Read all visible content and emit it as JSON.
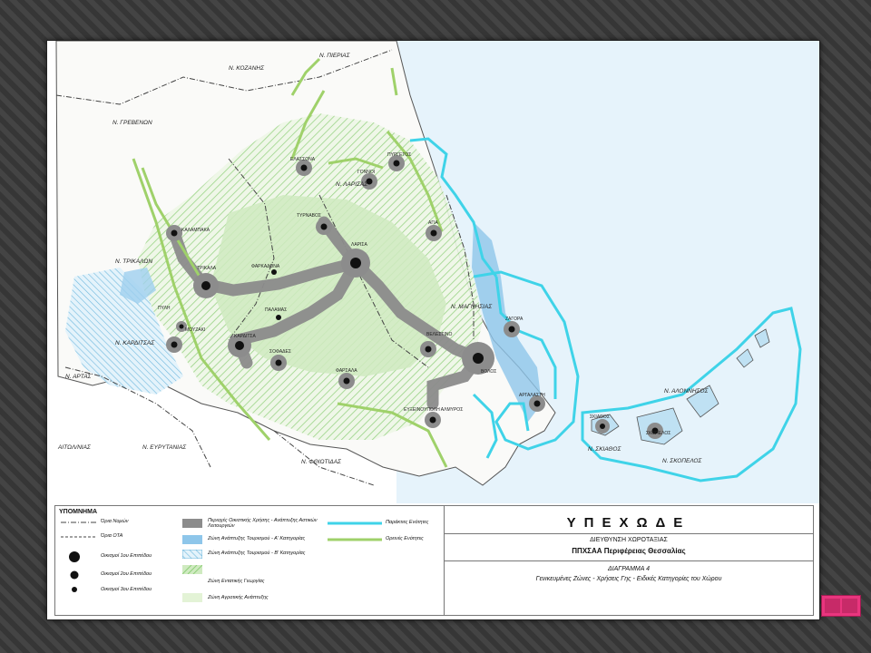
{
  "map": {
    "regions": {
      "kozani": "Ν. ΚΟΖΑΝΗΣ",
      "pieria": "Ν. ΠΙΕΡΙΑΣ",
      "grevena": "Ν. ΓΡΕΒΕΝΩΝ",
      "larisa": "Ν. ΛΑΡΙΣΑΣ",
      "trikala": "Ν. ΤΡΙΚΑΛΩΝ",
      "magnisia": "Ν. ΜΑΓΝΗΣΙΑΣ",
      "karditsa": "Ν. ΚΑΡΔΙΤΣΑΣ",
      "arta": "Ν. ΑΡΤΑΣ",
      "aitoloakarnania": "ΑΙΤΩΛ/ΝΙΑΣ",
      "evrytania": "Ν. ΕΥΡΥΤΑΝΙΑΣ",
      "fthiotida": "Ν. ΦΘΙΩΤΙΔΑΣ",
      "alonnisos": "Ν. ΑΛΟΝΝΗΣΟΣ",
      "skiathos": "Ν. ΣΚΙΑΘΟΣ",
      "skopelos": "Ν. ΣΚΟΠΕΛΟΣ"
    },
    "towns": {
      "elassona": "ΕΛΑΣΣΟΝΑ",
      "gonnoi": "ΓΟΝΝΟΙ",
      "pyrgetos": "ΠΥΡΓΕΤΟΣ",
      "tyrnavos": "ΤΥΡΝΑΒΟΣ",
      "agia": "ΑΓΙΑ",
      "larisa": "ΛΑΡΙΣΑ",
      "kalampaka": "ΚΑΛΑΜΠΑΚΑ",
      "trikala": "ΤΡΙΚΑΛΑ",
      "farkadona": "ΦΑΡΚΑΔΟΝΑ",
      "pyli": "ΠΥΛΗ",
      "mouzaki": "ΜΟΥΖΑΚΙ",
      "palamas": "ΠΑΛΑΜΑΣ",
      "karditsa": "ΚΑΡΔΙΤΣΑ",
      "sofades": "ΣΟΦΑΔΕΣ",
      "velestino": "ΒΕΛΕΣΤΙΝΟ",
      "zagora": "ΖΑΓΟΡΑ",
      "volos": "ΒΟΛΟΣ",
      "farsala": "ΦΑΡΣΑΛΑ",
      "almyros": "ΕΥΞΕΙΝΟΥΠΟΛΗ ΑΛΜΥΡΟΣ",
      "argalasti": "ΑΡΓΑΛΑΣΤΗ",
      "skiathos": "ΣΚΙΑΘΟΣ",
      "skopelos": "ΣΚΟΠΕΛΟΣ"
    }
  },
  "legend": {
    "title": "ΥΠΟΜΝΗΜΑ",
    "items": {
      "prefecture_border": "Όρια Νομών",
      "ota_border": "Όρια ΟΤΑ",
      "tier1": "Οικισμοί 1ου Επιπέδου",
      "tier2": "Οικισμοί 2ου Επιπέδου",
      "tier3": "Οικισμοί 3ου Επιπέδου",
      "urban_zone": "Περιοχές Οικιστικής Χρήσης - Ανάπτυξης Αστικών Λειτουργιών",
      "tourism_a": "Ζώνη Ανάπτυξης Τουρισμού - Α' Κατηγορίας",
      "tourism_b": "Ζώνη Ανάπτυξης Τουρισμού - Β' Κατηγορίας",
      "intensive_agri": "Ζώνη Εντατικής Γεωργίας",
      "agri_dev": "Ζώνη Αγροτικής Ανάπτυξης",
      "coastal_unit": "Παράκτιες Ενότητες",
      "mountain_unit": "Ορεινές Ενότητες"
    },
    "colors": {
      "coastal": "#3fd3e8",
      "mountain": "#9fd16a",
      "urban": "#8c8c8c",
      "tourism_a": "#8ec6ea",
      "agri": "#cfeac0"
    }
  },
  "title_block": {
    "ministry": "ΥΠΕΧΩΔΕ",
    "directorate": "ΔΙΕΥΘΥΝΣΗ ΧΩΡΟΤΑΞΙΑΣ",
    "plan": "ΠΠΧΣΑΑ Περιφέρειας Θεσσαλίας",
    "diagram": "ΔΙΑΓΡΑΜΜΑ 4",
    "description": "Γενικευμένες Ζώνες - Χρήσεις Γης - Ειδικές Κατηγορίες του Χώρου"
  },
  "nav": {
    "icon": "home-icon"
  }
}
